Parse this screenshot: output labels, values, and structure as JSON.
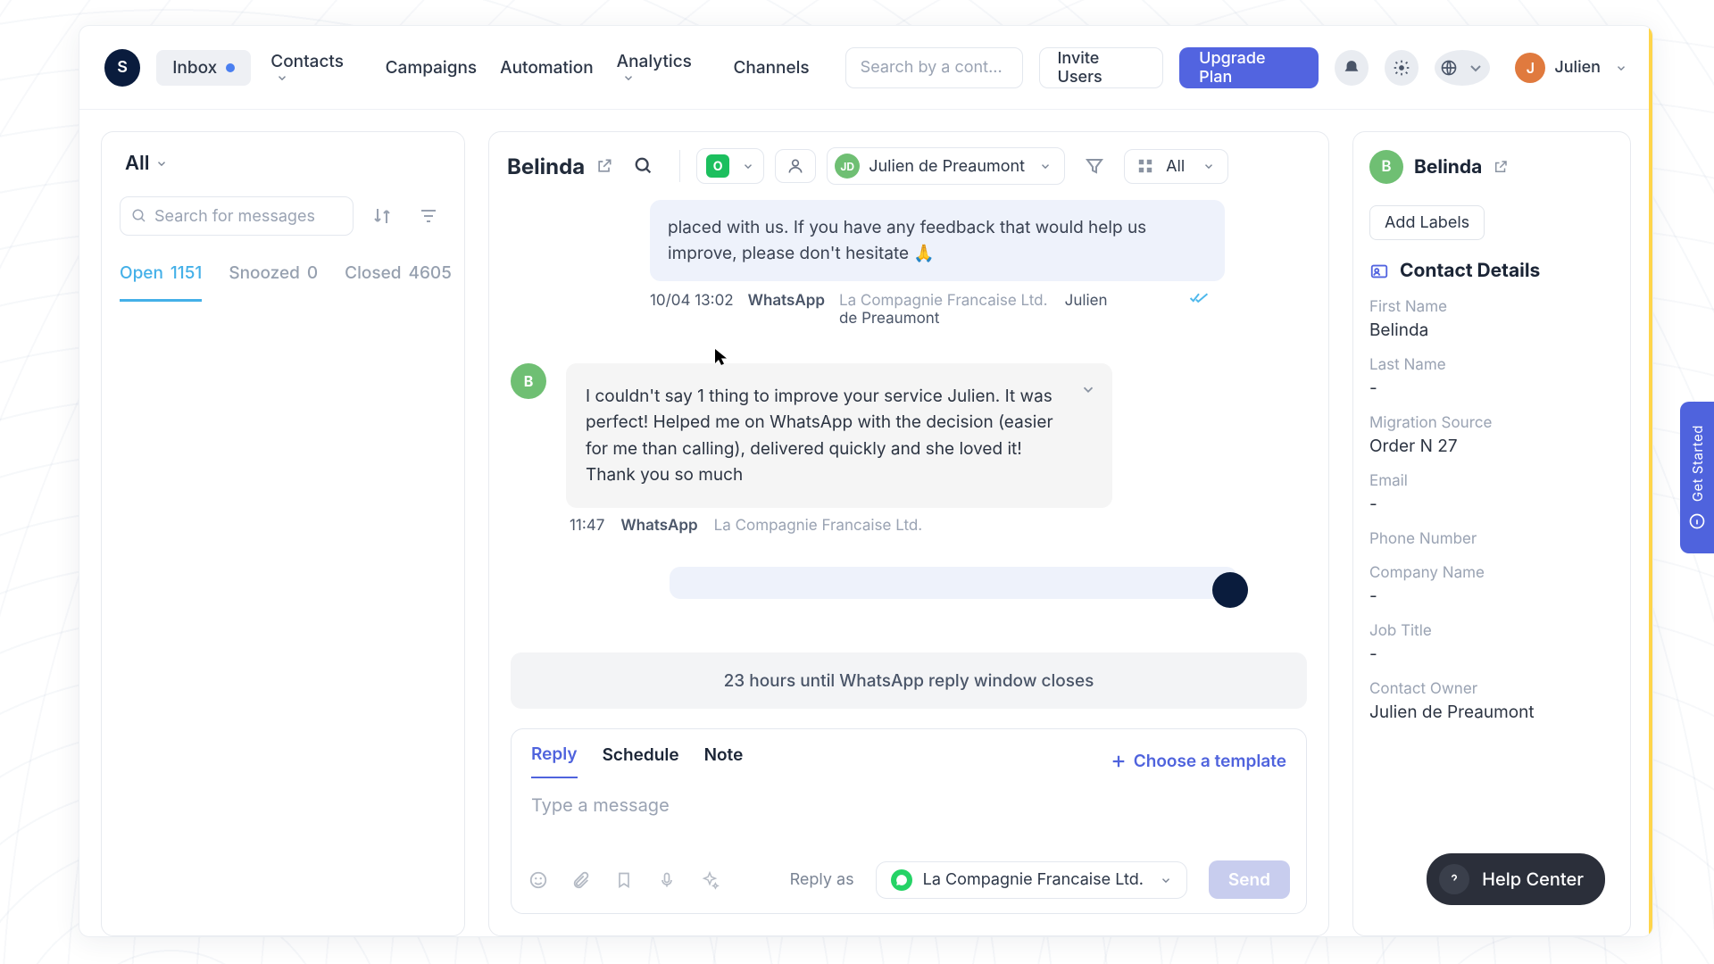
{
  "nav": {
    "logo_initial": "S",
    "items": {
      "inbox": "Inbox",
      "contacts": "Contacts",
      "campaigns": "Campaigns",
      "automation": "Automation",
      "analytics": "Analytics",
      "channels": "Channels"
    },
    "search_placeholder": "Search by a cont...",
    "invite": "Invite Users",
    "upgrade": "Upgrade Plan",
    "user": {
      "initial": "J",
      "name": "Julien"
    }
  },
  "left": {
    "filter_label": "All",
    "search_placeholder": "Search for messages",
    "tabs": {
      "open": {
        "label": "Open",
        "count": "1151"
      },
      "snoozed": {
        "label": "Snoozed",
        "count": "0"
      },
      "closed": {
        "label": "Closed",
        "count": "4605"
      }
    }
  },
  "conv": {
    "contact": "Belinda",
    "status_chip_letter": "O",
    "assignee": {
      "initials": "JD",
      "name": "Julien de Preaumont"
    },
    "view_label": "All",
    "out_msg_1": "placed with us. If you have any feedback that would help us improve, please don't hesitate 🙏",
    "out_meta_1": {
      "time": "10/04 13:02",
      "channel": "WhatsApp",
      "company": "La Compagnie Francaise Ltd.",
      "agent": "Julien de Preaumont"
    },
    "in_avatar": "B",
    "in_msg_1": "I couldn't say 1 thing to improve your service Julien. It was perfect! Helped me on WhatsApp with the decision (easier for me than calling), delivered quickly and she loved it! Thank you so much",
    "in_meta_1": {
      "time": "11:47",
      "channel": "WhatsApp",
      "company": "La Compagnie Francaise Ltd."
    },
    "reply_window": "23 hours until WhatsApp reply window closes"
  },
  "composer": {
    "tabs": {
      "reply": "Reply",
      "schedule": "Schedule",
      "note": "Note"
    },
    "choose_template": "Choose a template",
    "placeholder": "Type a message",
    "reply_as_label": "Reply as",
    "sender": "La Compagnie Francaise Ltd.",
    "send": "Send"
  },
  "right": {
    "name": "Belinda",
    "avatar": "B",
    "add_labels": "Add Labels",
    "section": "Contact Details",
    "fields": {
      "first_name": {
        "lbl": "First Name",
        "val": "Belinda"
      },
      "last_name": {
        "lbl": "Last Name",
        "val": "-"
      },
      "migration_source": {
        "lbl": "Migration Source",
        "val": "Order N 27"
      },
      "email": {
        "lbl": "Email",
        "val": "-"
      },
      "phone": {
        "lbl": "Phone Number",
        "val": ""
      },
      "company": {
        "lbl": "Company Name",
        "val": "-"
      },
      "job_title": {
        "lbl": "Job Title",
        "val": "-"
      },
      "contact_owner": {
        "lbl": "Contact Owner",
        "val": "Julien de Preau­mont"
      }
    }
  },
  "floating": {
    "get_started": "Get Started",
    "help_center": "Help Center"
  },
  "colors": {
    "primary": "#5264e0",
    "green": "#6fbf73",
    "navy": "#0a1c3d"
  }
}
